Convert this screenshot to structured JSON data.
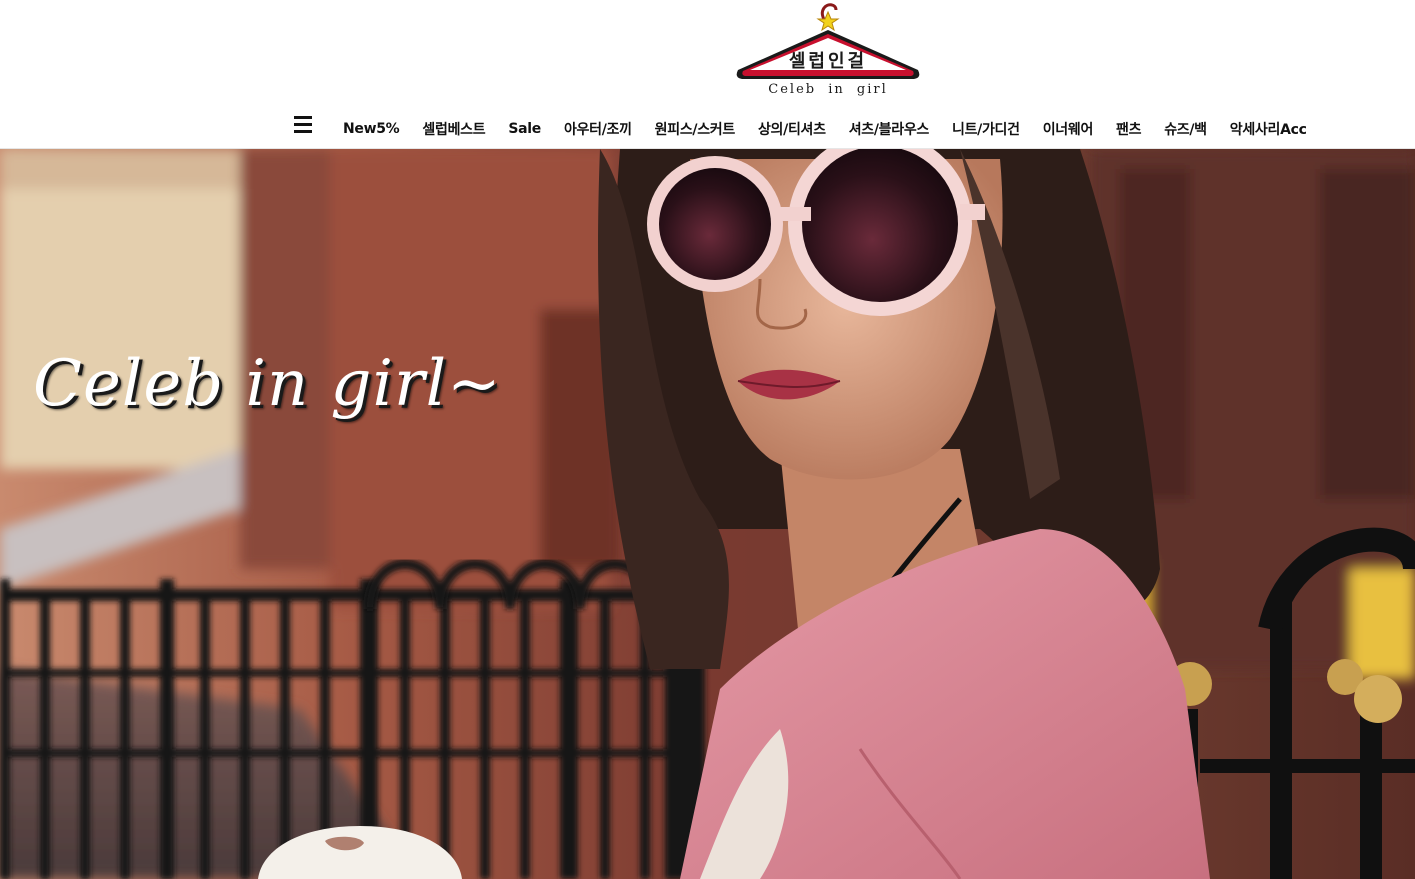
{
  "brand": {
    "logo_korean": "셀럽인걸",
    "logo_english": "Celeb in girl"
  },
  "nav": {
    "menu_icon": "hamburger-icon",
    "items": [
      {
        "label": "New5%"
      },
      {
        "label": "셀럽베스트"
      },
      {
        "label": "Sale"
      },
      {
        "label": "아우터/조끼"
      },
      {
        "label": "원피스/스커트"
      },
      {
        "label": "상의/티셔츠"
      },
      {
        "label": "셔츠/블라우스"
      },
      {
        "label": "니트/가디건"
      },
      {
        "label": "이너웨어"
      },
      {
        "label": "팬츠"
      },
      {
        "label": "슈즈/백"
      },
      {
        "label": "악세사리Acc"
      }
    ]
  },
  "hero": {
    "title": "Celeb in girl~"
  },
  "colors": {
    "logo_red": "#c8102e",
    "logo_star": "#f2d21b",
    "cardigan_pink": "#d9808f"
  }
}
